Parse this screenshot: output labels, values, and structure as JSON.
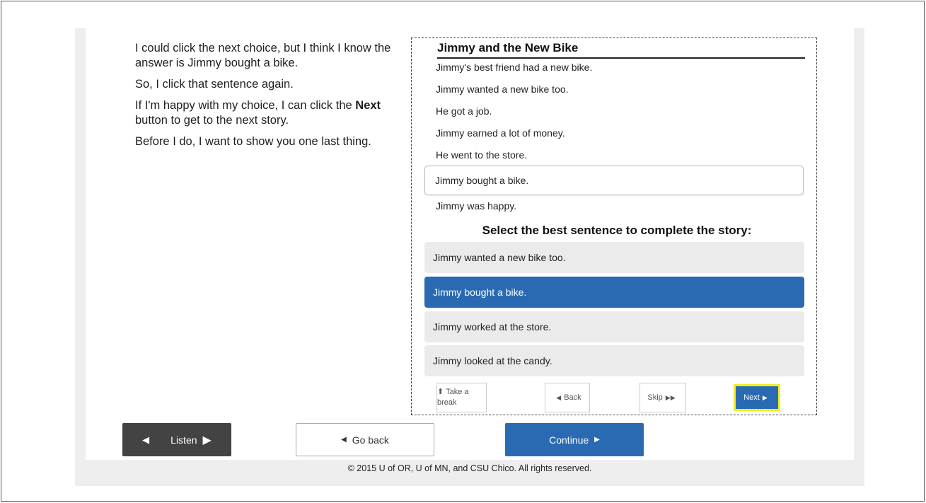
{
  "narration": {
    "p1": "I could click the next choice, but I think I know the answer is Jimmy bought a bike.",
    "p2": "So, I click that sentence again.",
    "p3_before": "If I'm happy with my choice, I can click the ",
    "p3_bold": "Next",
    "p3_after": " button to get to the next story.",
    "p4": "Before I do, I want to show you one last thing."
  },
  "story": {
    "title": "Jimmy and the New Bike",
    "lines": [
      "Jimmy's best friend had a new bike.",
      "Jimmy wanted a new bike too.",
      "He got a job.",
      "Jimmy earned a lot of money.",
      "He went to the store.",
      "Jimmy bought a bike.",
      "Jimmy was happy."
    ]
  },
  "prompt": "Select the best sentence to complete the story:",
  "choices": [
    "Jimmy wanted a new bike too.",
    "Jimmy bought a bike.",
    "Jimmy worked at the store.",
    "Jimmy looked at the candy."
  ],
  "selected_choice_index": 1,
  "nav": {
    "take_break": "Take a break",
    "back": "Back",
    "skip": "Skip",
    "next": "Next"
  },
  "bottom": {
    "listen": "Listen",
    "go_back": "Go back",
    "continue": "Continue"
  },
  "footer": "© 2015 U of OR, U of MN, and CSU Chico. All rights reserved.",
  "colors": {
    "accent": "#2a6ab3",
    "highlight": "#f4ee1c",
    "listen_bg": "#434343"
  }
}
